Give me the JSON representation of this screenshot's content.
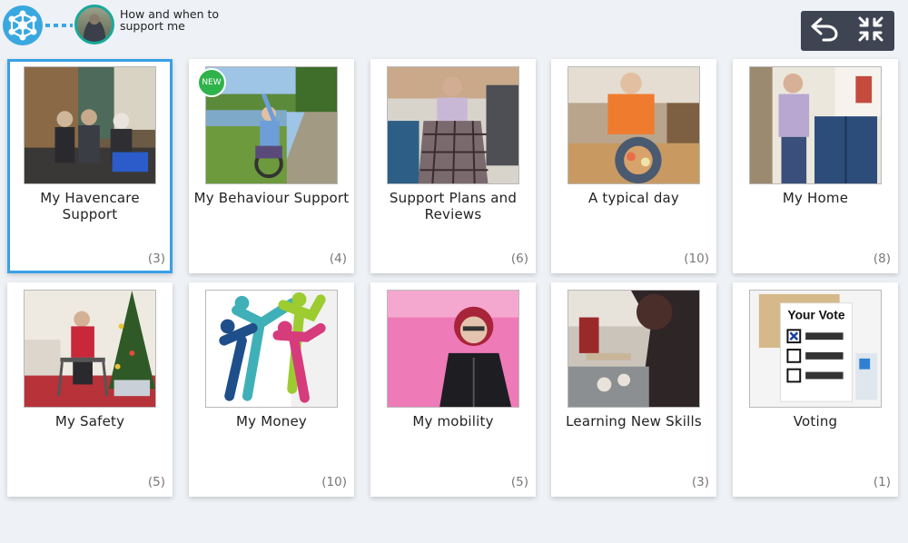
{
  "header": {
    "title": "How and when to support me",
    "back_icon": "undo-arrow-icon",
    "collapse_icon": "collapse-arrows-icon"
  },
  "colors": {
    "accent": "#39a7e0",
    "controls_bg": "#3e4452",
    "selected_border": "#3aa0e8",
    "new_badge": "#2fb34a"
  },
  "cards": [
    {
      "label": "My Havencare Support",
      "count": "(3)",
      "selected": true
    },
    {
      "label": "My Behaviour Support",
      "count": "(4)",
      "badge": "NEW"
    },
    {
      "label": "Support Plans and Reviews",
      "count": "(6)"
    },
    {
      "label": "A typical day",
      "count": "(10)"
    },
    {
      "label": "My Home",
      "count": "(8)"
    },
    {
      "label": "My Safety",
      "count": "(5)"
    },
    {
      "label": "My Money",
      "count": "(10)"
    },
    {
      "label": "My mobility",
      "count": "(5)"
    },
    {
      "label": "Learning New Skills",
      "count": "(3)"
    },
    {
      "label": "Voting",
      "count": "(1)"
    }
  ],
  "voting_image": {
    "heading": "Your Vote"
  }
}
